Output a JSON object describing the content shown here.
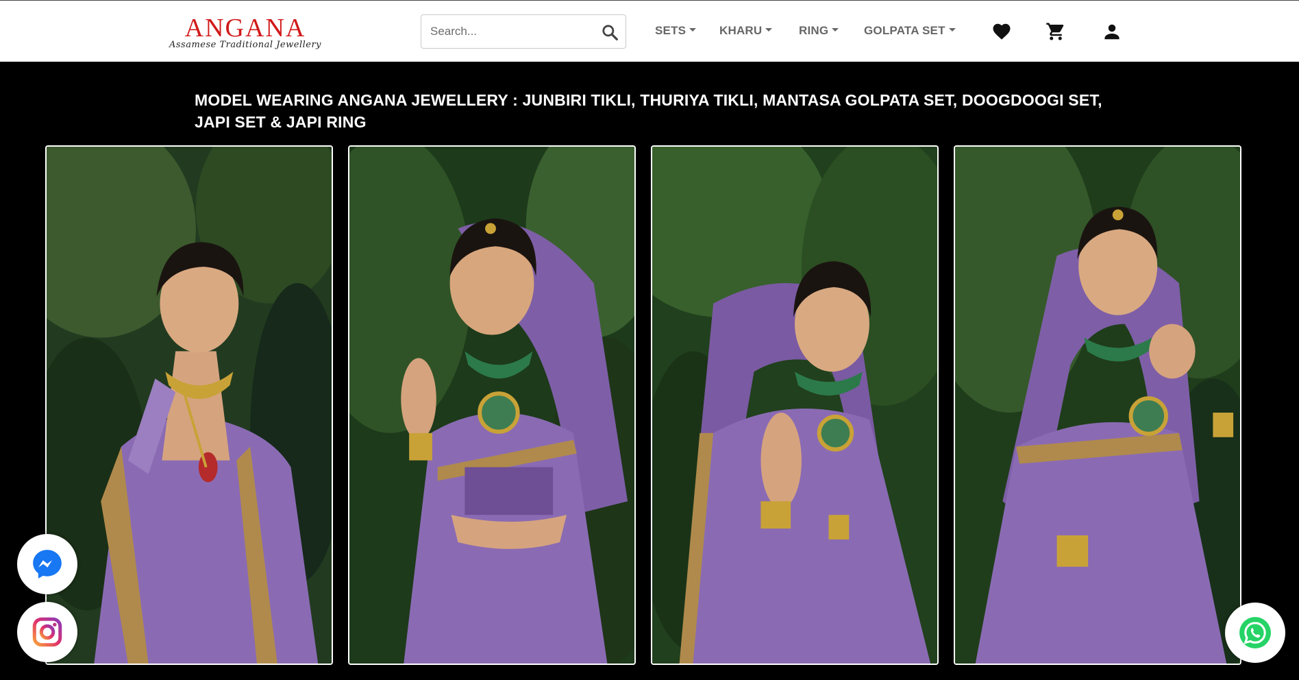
{
  "brand": {
    "name": "ANGANA",
    "tagline": "Assamese Traditional Jewellery",
    "color": "#d11a1a"
  },
  "search": {
    "placeholder": "Search...",
    "value": "",
    "icon": "search-icon"
  },
  "nav": {
    "items": [
      {
        "label": "SETS",
        "icon": "chevron-down-icon"
      },
      {
        "label": "KHARU",
        "icon": "chevron-down-icon"
      },
      {
        "label": "RING",
        "icon": "chevron-down-icon"
      },
      {
        "label": "GOLPATA SET",
        "icon": "chevron-down-icon"
      }
    ],
    "icons": [
      "heart-icon",
      "cart-icon",
      "user-icon"
    ]
  },
  "hero": {
    "caption": "MODEL WEARING ANGANA JEWELLERY : JUNBIRI TIKLI, THURIYA TIKLI, MANTASA GOLPATA SET, DOOGDOOGI SET, JAPI SET & JAPI RING"
  },
  "gallery": {
    "photos": [
      {
        "subject": "model-photo"
      },
      {
        "subject": "model-photo"
      },
      {
        "subject": "model-photo"
      },
      {
        "subject": "model-photo"
      }
    ]
  },
  "floating": {
    "messenger": "messenger-icon",
    "instagram": "instagram-icon",
    "whatsapp": "whatsapp-icon",
    "whatsapp_color": "#25d366"
  },
  "colors": {
    "header_bg": "#ffffff",
    "page_bg": "#000000",
    "nav_text": "#666666",
    "saree": "#8a6bb3",
    "foliage": "#1f3d1a"
  }
}
